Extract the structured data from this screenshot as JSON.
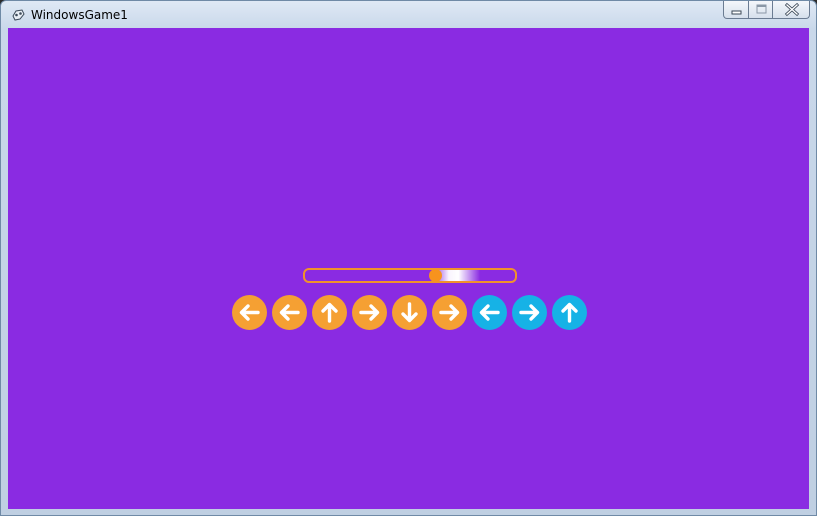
{
  "window": {
    "title": "WindowsGame1",
    "background_color": "#8A2BE2",
    "caption_buttons": [
      "minimize-icon",
      "maximize-icon",
      "close-icon"
    ]
  },
  "game": {
    "progress_fraction": 0.62,
    "progress_track_color": "#F0922C",
    "marker_color": "#F7931E",
    "arrow_sequence": [
      {
        "direction": "left",
        "color": "#F5A033"
      },
      {
        "direction": "left",
        "color": "#F5A033"
      },
      {
        "direction": "up",
        "color": "#F5A033"
      },
      {
        "direction": "right",
        "color": "#F5A033"
      },
      {
        "direction": "down",
        "color": "#F5A033"
      },
      {
        "direction": "right",
        "color": "#F5A033"
      },
      {
        "direction": "left",
        "color": "#16B2E6"
      },
      {
        "direction": "right",
        "color": "#16B2E6"
      },
      {
        "direction": "up",
        "color": "#16B2E6"
      }
    ]
  }
}
